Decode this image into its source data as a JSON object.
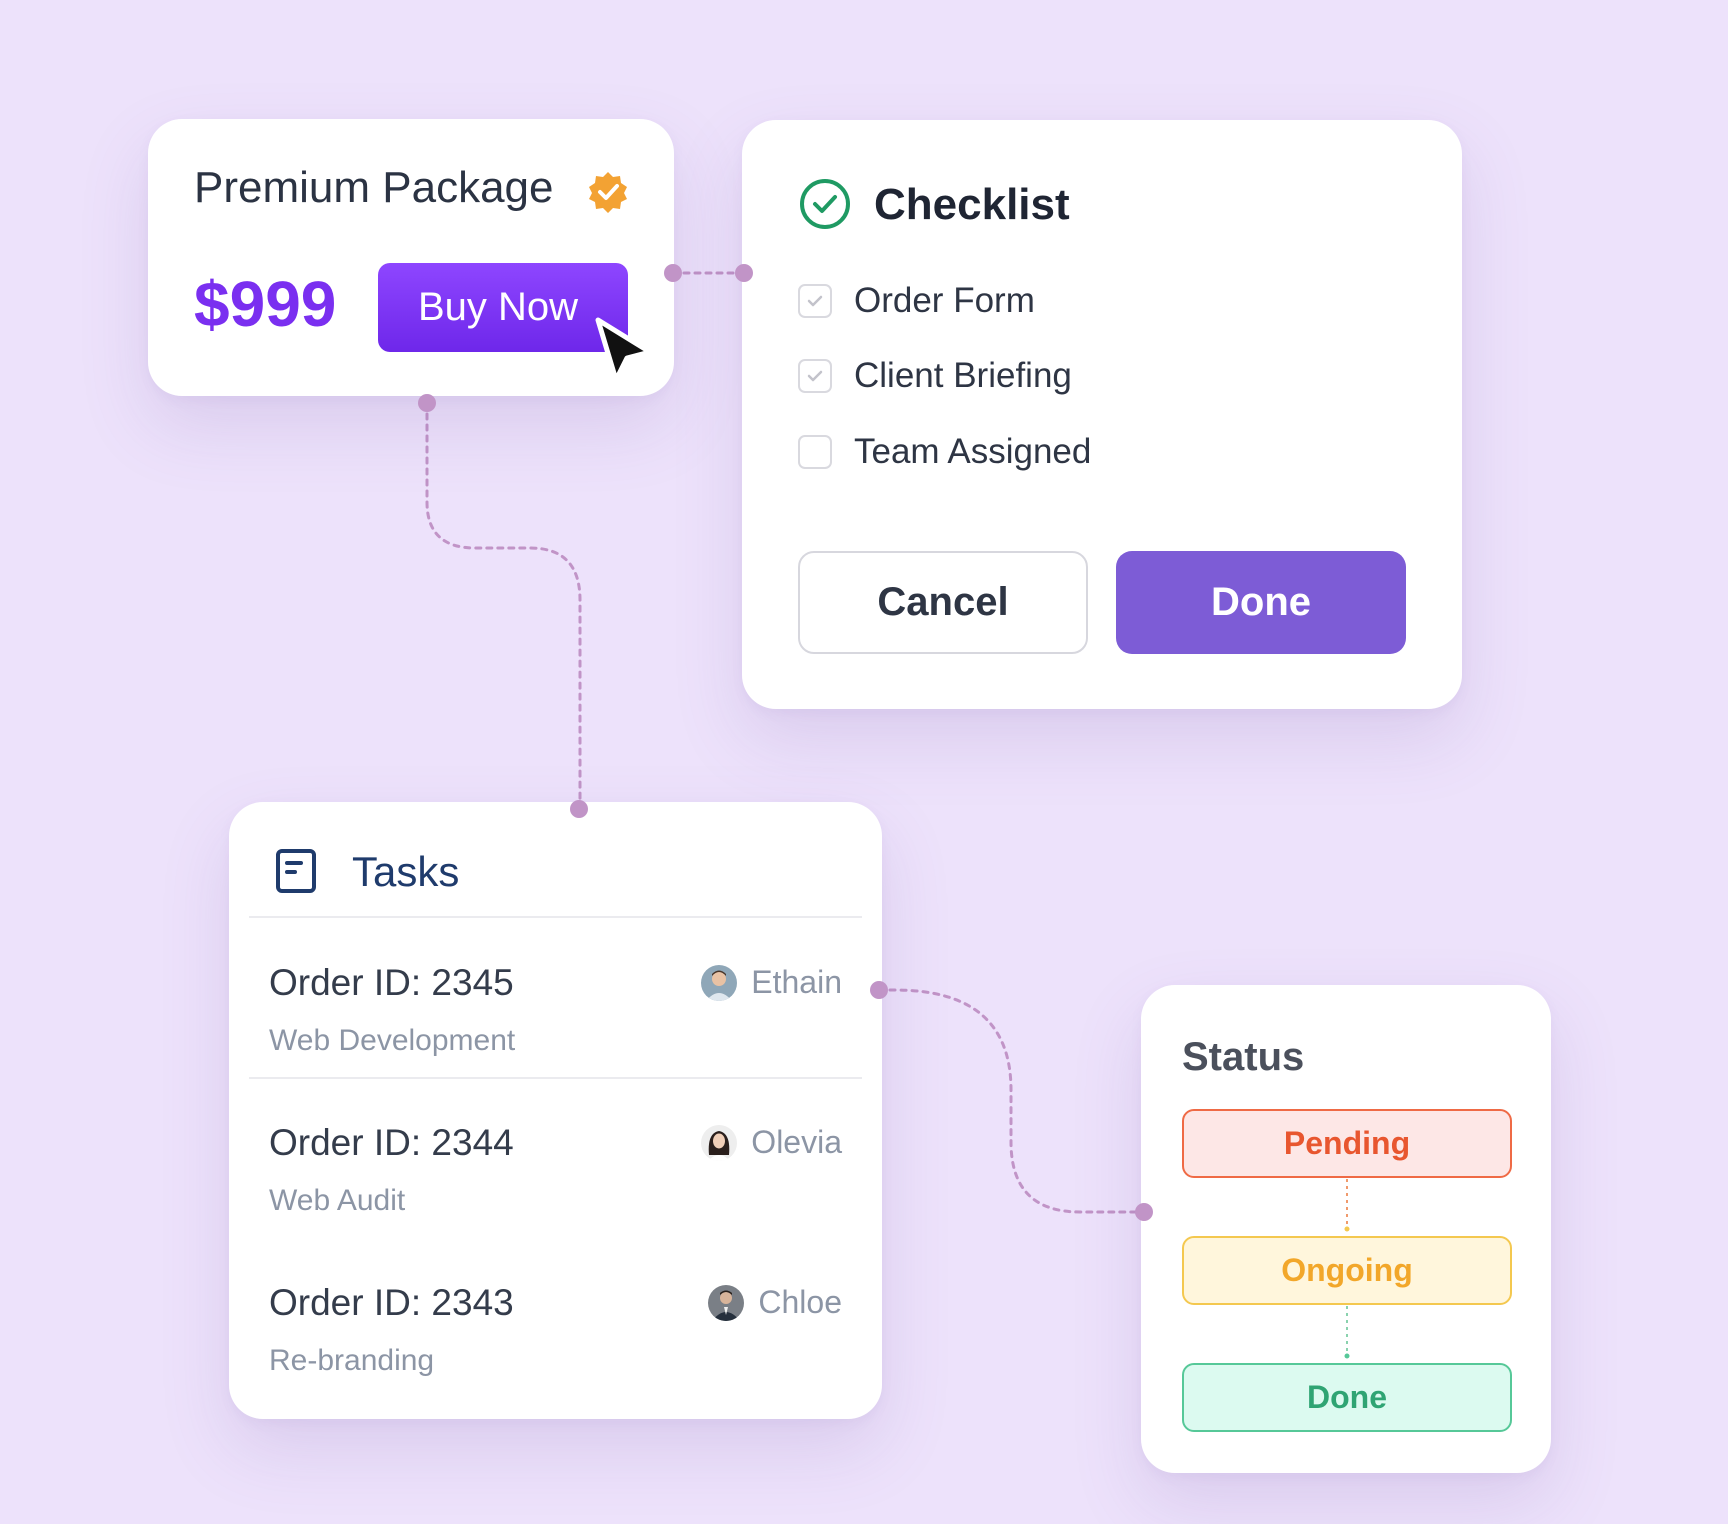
{
  "premium": {
    "title": "Premium Package",
    "badge_icon": "verified-badge-icon",
    "price": "$999",
    "buy_label": "Buy Now"
  },
  "checklist": {
    "title": "Checklist",
    "items": [
      {
        "label": "Order Form",
        "checked": true
      },
      {
        "label": "Client Briefing",
        "checked": true
      },
      {
        "label": "Team Assigned",
        "checked": false
      }
    ],
    "cancel_label": "Cancel",
    "done_label": "Done"
  },
  "tasks": {
    "title": "Tasks",
    "rows": [
      {
        "order": "Order ID: 2345",
        "category": "Web Development",
        "person": "Ethain"
      },
      {
        "order": "Order ID: 2344",
        "category": "Web Audit",
        "person": "Olevia"
      },
      {
        "order": "Order ID: 2343",
        "category": "Re-branding",
        "person": "Chloe"
      }
    ]
  },
  "status": {
    "title": "Status",
    "items": [
      {
        "label": "Pending",
        "text_color": "#e8562f",
        "bg": "#fde7e6",
        "border": "#ef6a45"
      },
      {
        "label": "Ongoing",
        "text_color": "#f2a72a",
        "bg": "#fff6dc",
        "border": "#f4c84f"
      },
      {
        "label": "Done",
        "text_color": "#2fa473",
        "bg": "#dcfaf0",
        "border": "#56c898"
      }
    ]
  },
  "colors": {
    "background": "#ede2fb",
    "accent": "#7a2ff0",
    "done_button": "#7d5cd6",
    "connector": "#c194c7"
  }
}
